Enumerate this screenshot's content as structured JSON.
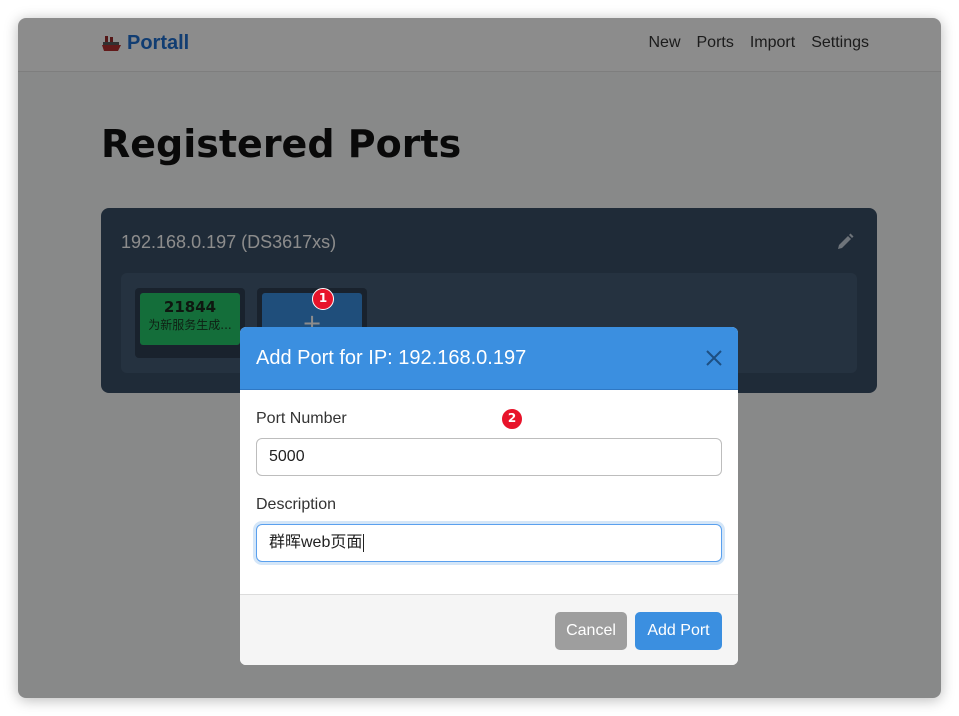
{
  "navbar": {
    "brand": "Portall",
    "links": [
      "New",
      "Ports",
      "Import",
      "Settings"
    ]
  },
  "page": {
    "title": "Registered Ports"
  },
  "ip_card": {
    "title": "192.168.0.197 (DS3617xs)",
    "ports": [
      {
        "number": "21844",
        "description": "为新服务生成..."
      }
    ],
    "add_symbol": "+"
  },
  "modal": {
    "title": "Add Port for IP: 192.168.0.197",
    "port_label": "Port Number",
    "port_value": "5000",
    "description_label": "Description",
    "description_value": "群晖web页面",
    "cancel_label": "Cancel",
    "add_label": "Add Port"
  },
  "annotations": {
    "badge1": "1",
    "badge2": "2"
  },
  "colors": {
    "accent": "#3b8fe0",
    "brand": "#1f6fd0",
    "card": "#3a4f66",
    "port_tile": "#26c96b",
    "badge": "#e8132a"
  }
}
